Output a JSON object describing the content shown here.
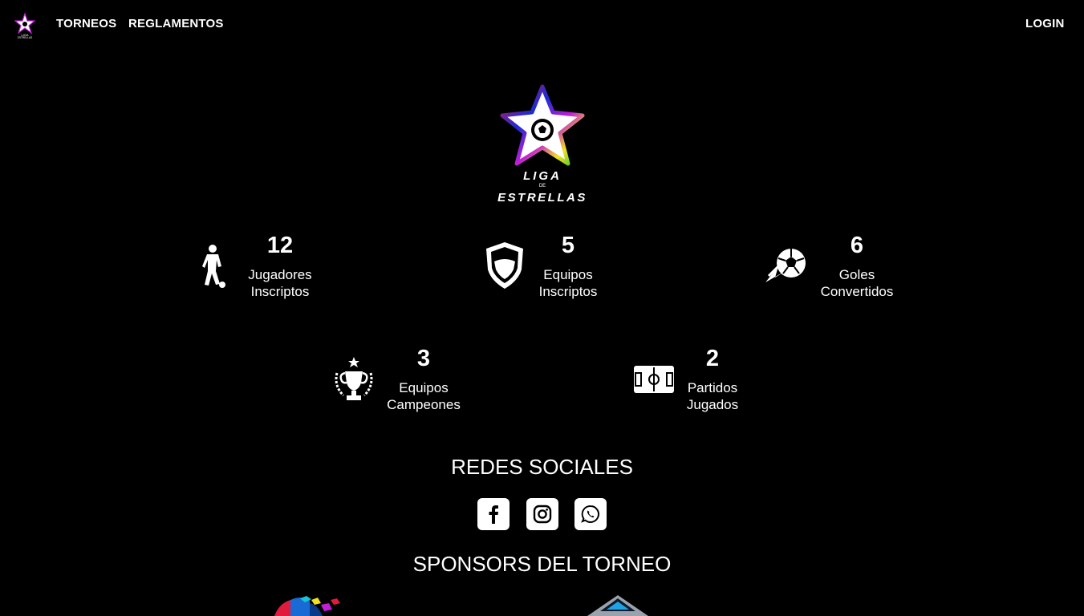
{
  "nav": {
    "links": [
      "TORNEOS",
      "REGLAMENTOS"
    ],
    "login": "LOGIN"
  },
  "hero": {
    "logo_line1": "LIGA",
    "logo_line2": "DE",
    "logo_line3": "ESTRELLAS"
  },
  "stats": [
    {
      "value": "12",
      "label1": "Jugadores",
      "label2": "Inscriptos",
      "icon": "player-icon"
    },
    {
      "value": "5",
      "label1": "Equipos",
      "label2": "Inscriptos",
      "icon": "shield-icon"
    },
    {
      "value": "6",
      "label1": "Goles",
      "label2": "Convertidos",
      "icon": "ball-icon"
    },
    {
      "value": "3",
      "label1": "Equipos",
      "label2": "Campeones",
      "icon": "trophy-icon"
    },
    {
      "value": "2",
      "label1": "Partidos",
      "label2": "Jugados",
      "icon": "field-icon"
    }
  ],
  "social": {
    "title": "REDES SOCIALES",
    "items": [
      "facebook-icon",
      "instagram-icon",
      "whatsapp-icon"
    ]
  },
  "sponsors": {
    "title": "SPONSORS DEL TORNEO"
  },
  "colors": {
    "background": "#000000",
    "text": "#ffffff",
    "star_gradient": [
      "#1a2bd6",
      "#c21fd6",
      "#e11b3c",
      "#17c43a",
      "#f3e21b"
    ]
  }
}
